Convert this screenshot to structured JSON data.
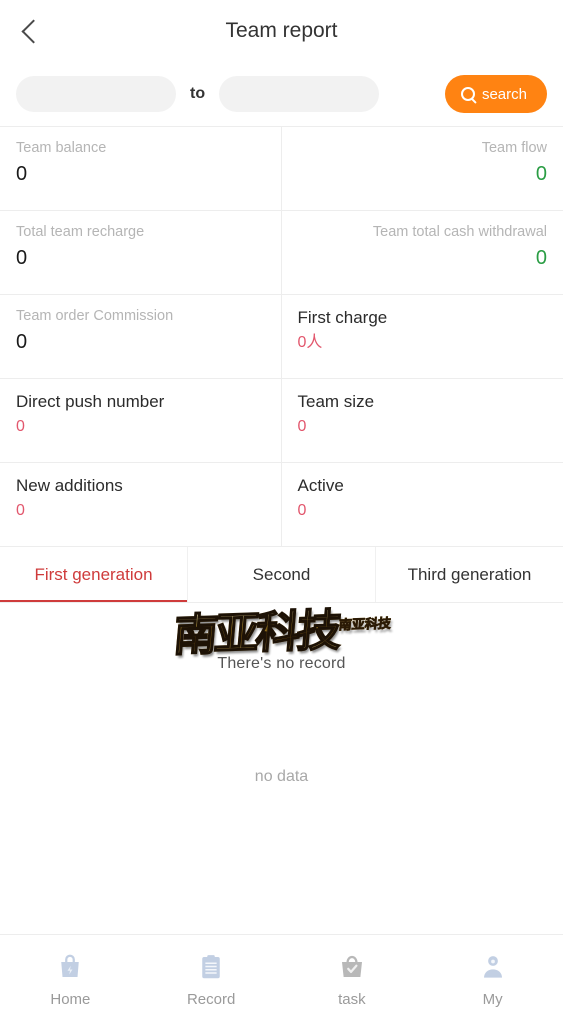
{
  "header": {
    "back_icon": "chevron-left-icon",
    "title": "Team report"
  },
  "search": {
    "start_date_value": "",
    "start_date_placeholder": "",
    "end_date_value": "",
    "end_date_placeholder": "",
    "separator": "to",
    "button_label": "search",
    "button_icon": "search-icon",
    "button_color": "#ff8312"
  },
  "stats": {
    "rows": [
      {
        "left": {
          "label": "Team balance",
          "value": "0",
          "value_color": "#1a1a1a",
          "label_style": "muted",
          "align": "left"
        },
        "right": {
          "label": "Team flow",
          "value": "0",
          "value_color": "#2a9d44",
          "label_style": "muted",
          "align": "right"
        }
      },
      {
        "left": {
          "label": "Total team recharge",
          "value": "0",
          "value_color": "#1a1a1a",
          "label_style": "muted",
          "align": "left"
        },
        "right": {
          "label": "Team total cash withdrawal",
          "value": "0",
          "value_color": "#2a9d44",
          "label_style": "muted",
          "align": "right"
        }
      },
      {
        "left": {
          "label": "Team order Commission",
          "value": "0",
          "value_color": "#1a1a1a",
          "label_style": "muted",
          "align": "left"
        },
        "right": {
          "label": "First charge",
          "value": "0人",
          "value_color": "#e2576d",
          "label_style": "dark",
          "align": "left"
        }
      },
      {
        "left": {
          "label": "Direct push number",
          "value": "0",
          "value_color": "#e2576d",
          "label_style": "dark",
          "align": "left"
        },
        "right": {
          "label": "Team size",
          "value": "0",
          "value_color": "#e2576d",
          "label_style": "dark",
          "align": "left"
        }
      },
      {
        "left": {
          "label": "New additions",
          "value": "0",
          "value_color": "#e2576d",
          "label_style": "dark",
          "align": "left"
        },
        "right": {
          "label": "Active",
          "value": "0",
          "value_color": "#e2576d",
          "label_style": "dark",
          "align": "left"
        }
      }
    ]
  },
  "tabs": {
    "active_color": "#cf3b3b",
    "items": [
      {
        "label": "First generation",
        "active": true
      },
      {
        "label": "Second",
        "active": false
      },
      {
        "label": "Third generation",
        "active": false
      }
    ]
  },
  "content": {
    "no_record_text": "There's no record",
    "no_data_text": "no data",
    "watermark_text": "南亚科技",
    "watermark_sup": "南亚科技"
  },
  "tabbar": {
    "items": [
      {
        "label": "Home",
        "icon": "shopping-bag-icon",
        "color": "#c2cfe3"
      },
      {
        "label": "Record",
        "icon": "clipboard-icon",
        "color": "#c2cfe3"
      },
      {
        "label": "task",
        "icon": "task-basket-icon",
        "color": "#b8b8b8"
      },
      {
        "label": "My",
        "icon": "user-icon",
        "color": "#c2cfe3"
      }
    ]
  }
}
